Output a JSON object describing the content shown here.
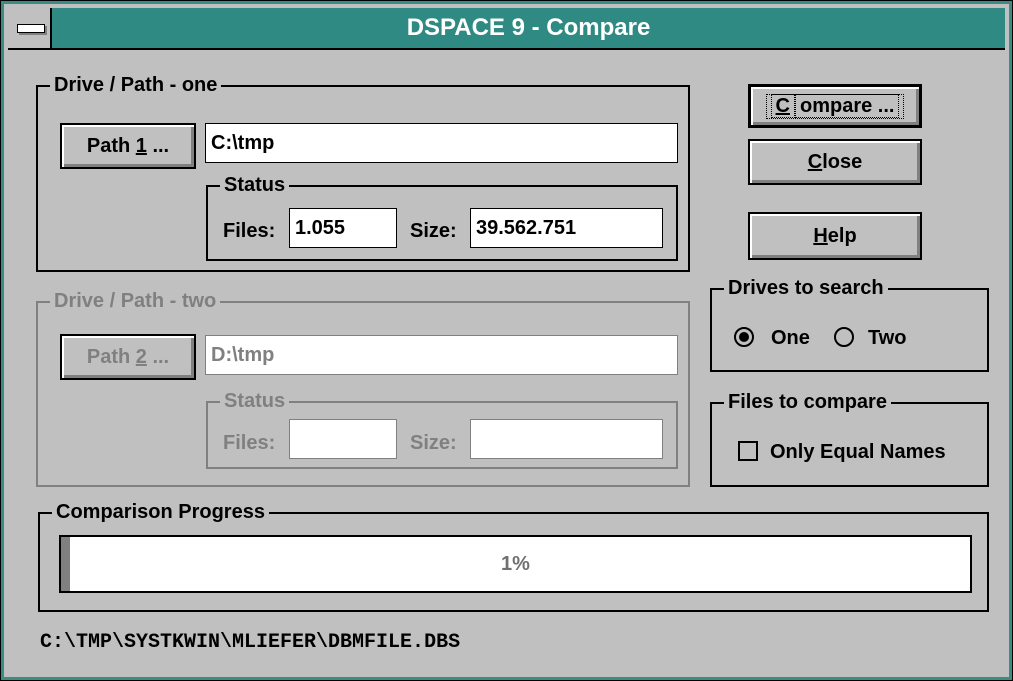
{
  "window": {
    "title": "DSPACE 9 - Compare"
  },
  "path_one": {
    "group_label": "Drive / Path - one",
    "button": {
      "pre": "Path ",
      "accel": "1",
      "post": " ..."
    },
    "path_value": "C:\\tmp",
    "status_label": "Status",
    "files_label": "Files:",
    "files_value": "1.055",
    "size_label": "Size:",
    "size_value": "39.562.751"
  },
  "path_two": {
    "group_label": "Drive / Path - two",
    "button": {
      "pre": "Path ",
      "accel": "2",
      "post": " ..."
    },
    "path_value": "D:\\tmp",
    "status_label": "Status",
    "files_label": "Files:",
    "files_value": "",
    "size_label": "Size:",
    "size_value": ""
  },
  "buttons": {
    "compare": {
      "accel": "C",
      "rest": "ompare ..."
    },
    "close": {
      "accel": "C",
      "rest": "lose"
    },
    "help": {
      "accel": "H",
      "rest": "elp"
    }
  },
  "drives": {
    "group_label": "Drives to search",
    "options": [
      "One",
      "Two"
    ],
    "selected": "One"
  },
  "files_compare": {
    "group_label": "Files to compare",
    "checkbox_label": "Only Equal Names",
    "checked": false
  },
  "progress": {
    "group_label": "Comparison Progress",
    "percent": 1,
    "percent_text": "1%"
  },
  "status_path": "C:\\TMP\\SYSTKWIN\\MLIEFER\\DBMFILE.DBS"
}
